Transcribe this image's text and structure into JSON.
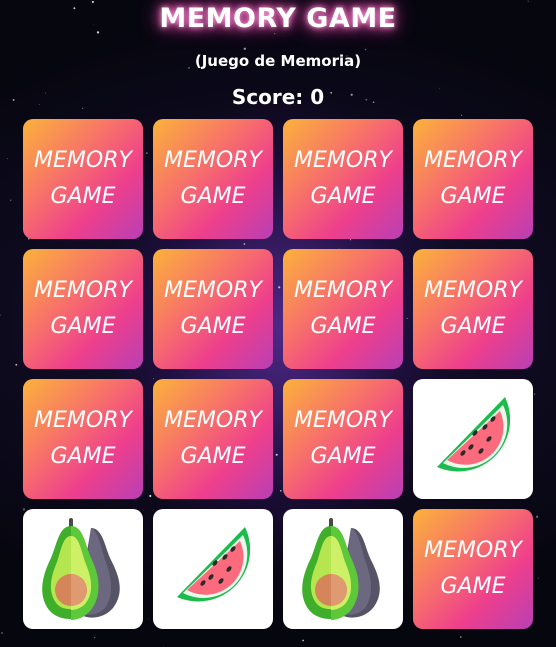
{
  "header": {
    "title": "MEMORY GAME",
    "subtitle": "(Juego de Memoria)",
    "score_label": "Score: 0"
  },
  "card_back_text": "MEMORY\nGAME",
  "cards": [
    {
      "state": "hidden"
    },
    {
      "state": "hidden"
    },
    {
      "state": "hidden"
    },
    {
      "state": "hidden"
    },
    {
      "state": "hidden"
    },
    {
      "state": "hidden"
    },
    {
      "state": "hidden"
    },
    {
      "state": "hidden"
    },
    {
      "state": "hidden"
    },
    {
      "state": "hidden"
    },
    {
      "state": "hidden"
    },
    {
      "state": "revealed",
      "icon": "watermelon-icon"
    },
    {
      "state": "revealed",
      "icon": "avocado-icon"
    },
    {
      "state": "revealed",
      "icon": "watermelon-icon"
    },
    {
      "state": "revealed",
      "icon": "avocado-icon"
    },
    {
      "state": "hidden"
    }
  ],
  "colors": {
    "card_gradient": [
      "#fbb23c",
      "#f7706a",
      "#ee3f8c",
      "#b83fb5"
    ],
    "revealed_background": "#ffffff",
    "title_glow": "#ff5fc0"
  }
}
